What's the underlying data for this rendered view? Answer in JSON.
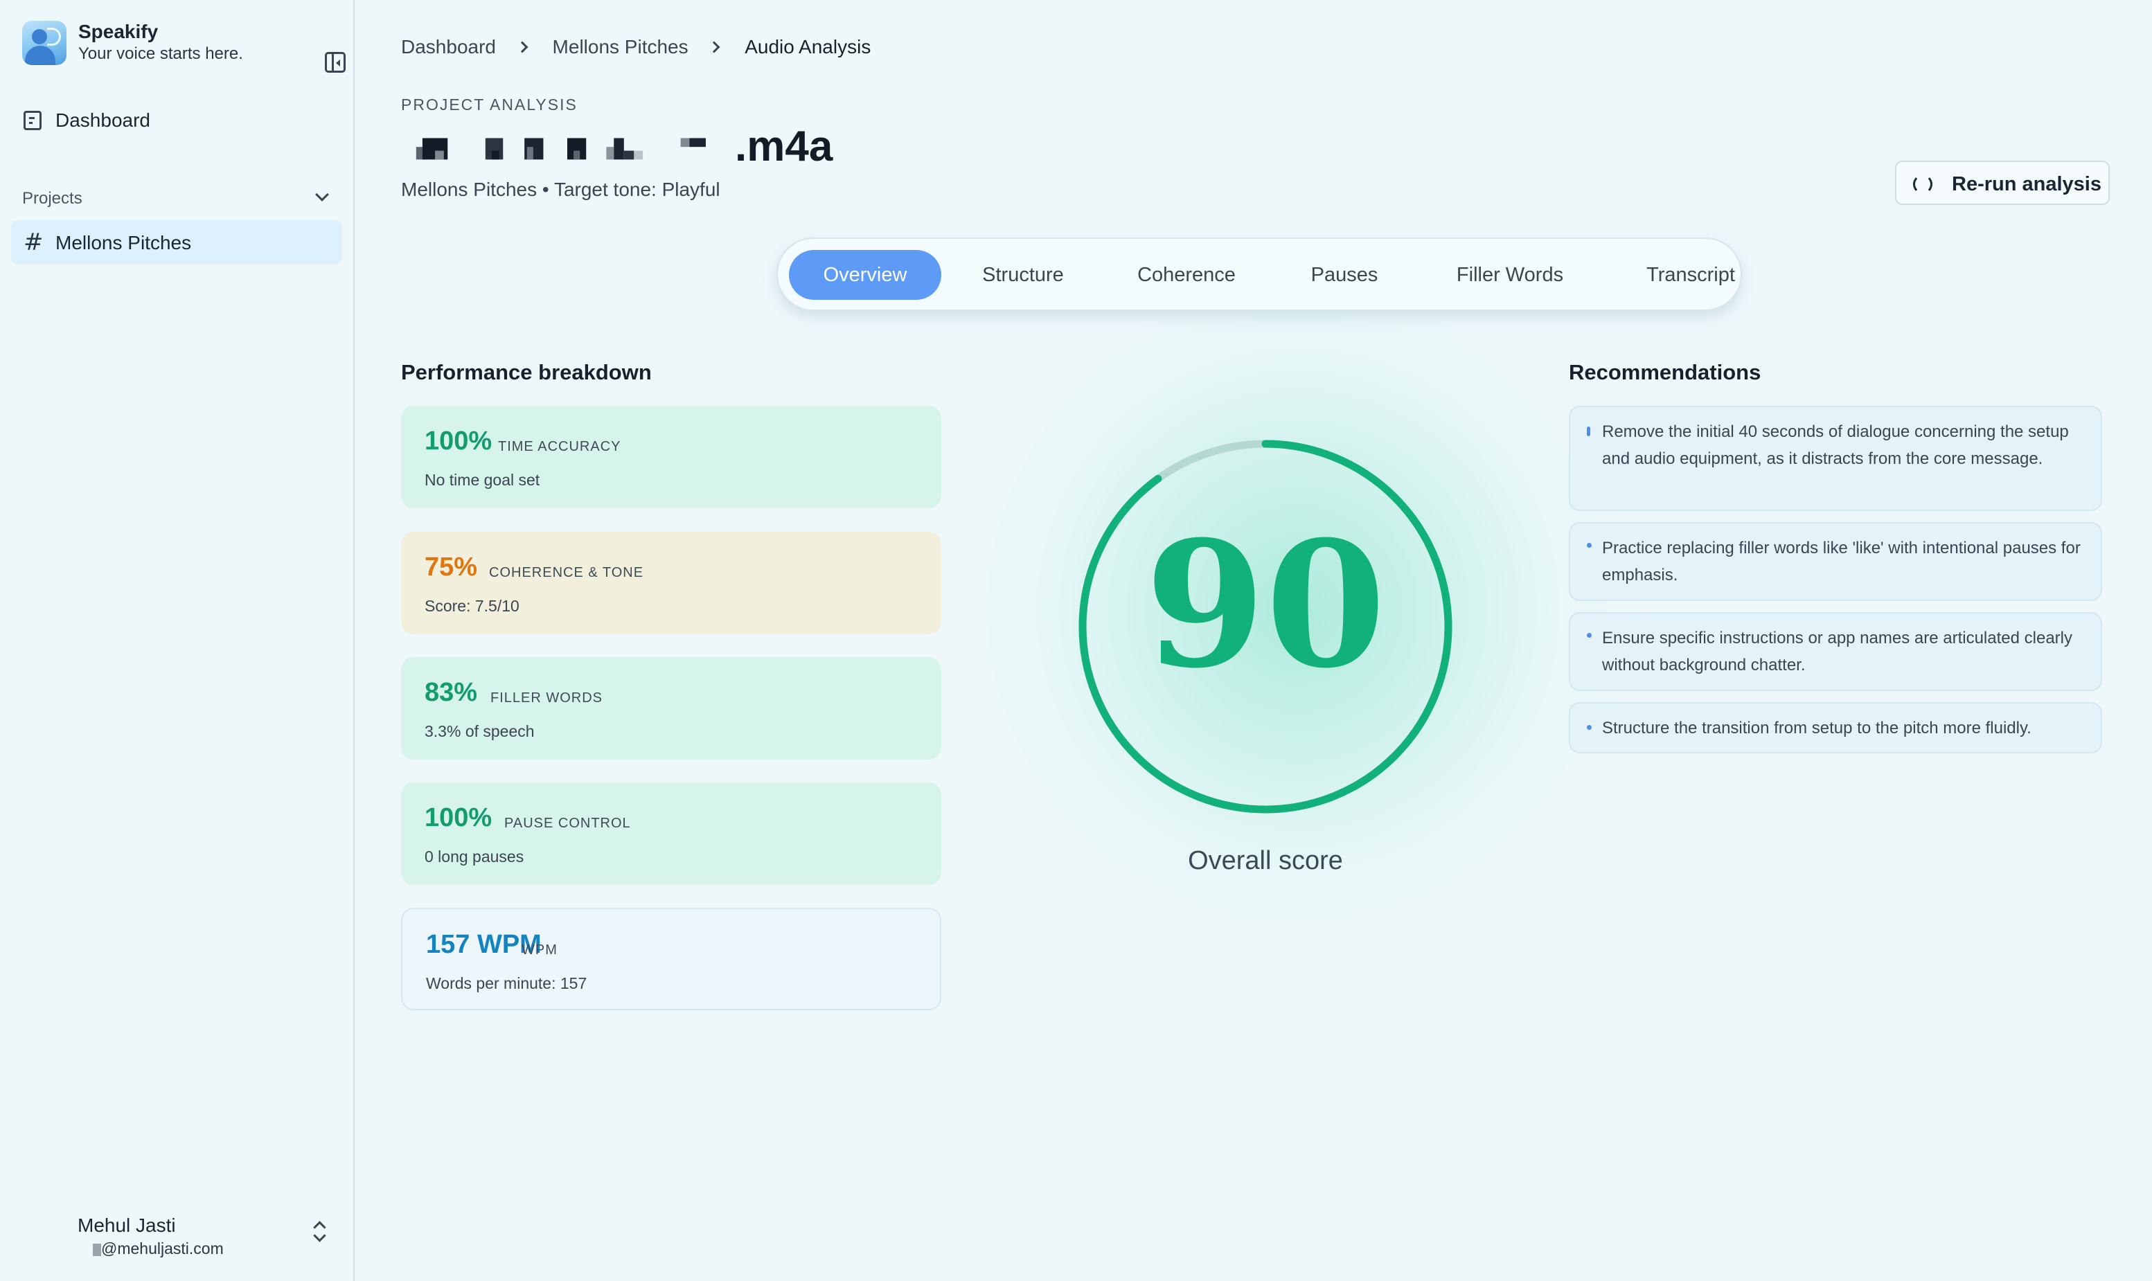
{
  "app": {
    "name": "Speakify",
    "tagline": "Your voice starts here."
  },
  "sidebar": {
    "dashboard_label": "Dashboard",
    "projects_label": "Projects",
    "projects": [
      {
        "label": "Mellons Pitches"
      }
    ]
  },
  "user": {
    "name": "Mehul Jasti",
    "email": "@mehuljasti.com"
  },
  "breadcrumb": [
    "Dashboard",
    "Mellons Pitches",
    "Audio Analysis"
  ],
  "header": {
    "eyebrow": "PROJECT ANALYSIS",
    "file_extension": ".m4a",
    "subtitle": "Mellons Pitches • Target tone: Playful",
    "rerun_label": "Re-run analysis"
  },
  "tabs": [
    {
      "label": "Overview",
      "active": true
    },
    {
      "label": "Structure"
    },
    {
      "label": "Coherence"
    },
    {
      "label": "Pauses"
    },
    {
      "label": "Filler Words"
    },
    {
      "label": "Transcript"
    }
  ],
  "performance": {
    "title": "Performance breakdown",
    "metrics": [
      {
        "value": "100%",
        "caption": "TIME ACCURACY",
        "sub": "No time goal set",
        "color": "#129d6b"
      },
      {
        "value": "75%",
        "caption": "COHERENCE & TONE",
        "sub": "Score: 7.5/10",
        "color": "#e1760f"
      },
      {
        "value": "83%",
        "caption": "FILLER WORDS",
        "sub": "3.3% of speech",
        "color": "#129d6b"
      },
      {
        "value": "100%",
        "caption": "PAUSE CONTROL",
        "sub": "0 long pauses",
        "color": "#129d6b"
      },
      {
        "value": "157 WPM",
        "caption": "WPM",
        "sub": "Words per minute: 157",
        "color": "#1683c1"
      }
    ]
  },
  "score": {
    "value": "90",
    "fraction": 0.9,
    "label": "Overall score",
    "ring_color": "#12b07a",
    "track_color": "#b6d8d2"
  },
  "recommendations": {
    "title": "Recommendations",
    "items": [
      "Remove the initial 40 seconds of dialogue concerning the setup and audio equipment, as it distracts from the core message.",
      "Practice replacing filler words like 'like' with intentional pauses for emphasis.",
      "Ensure specific instructions or app names are articulated clearly without background chatter.",
      "Structure the transition from setup to the pitch more fluidly."
    ]
  }
}
